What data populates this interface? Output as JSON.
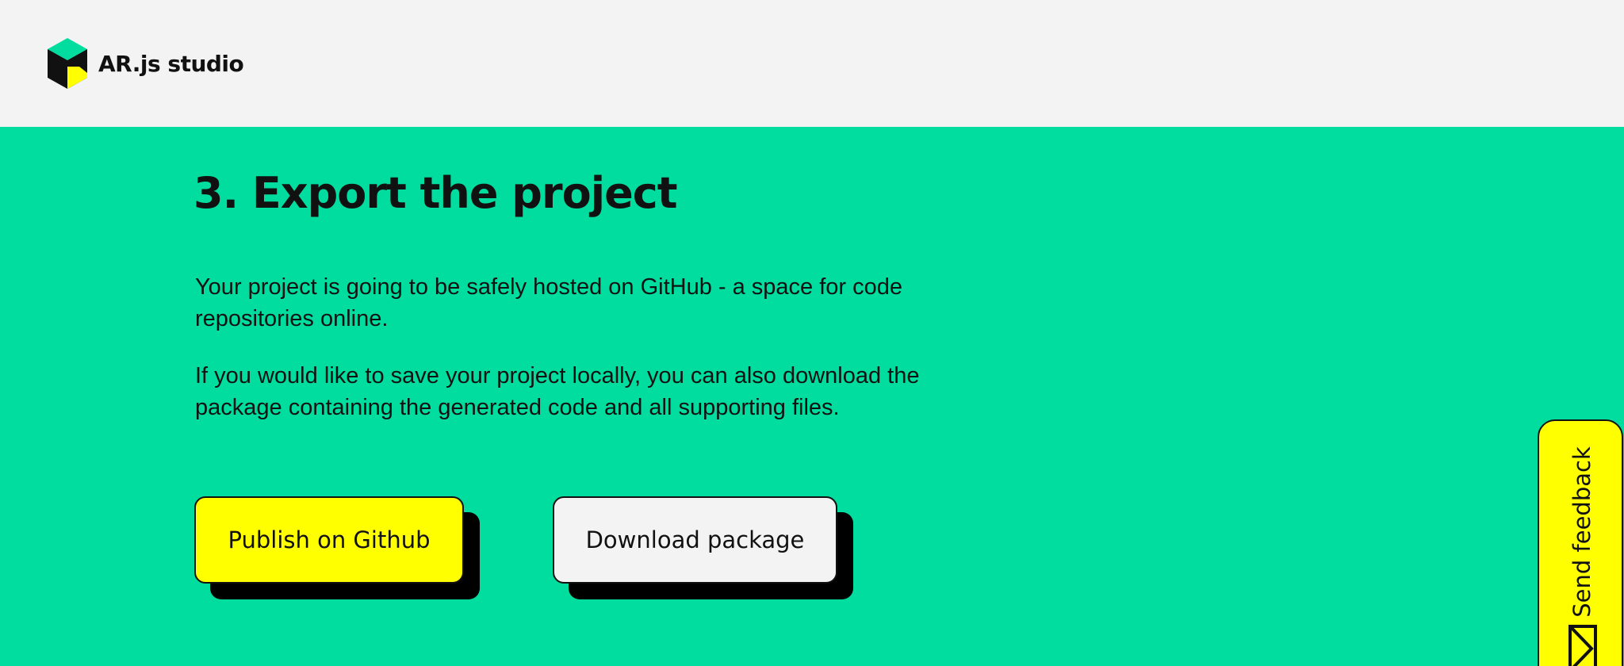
{
  "header": {
    "brand_name": "AR.js studio",
    "logo_icon": "arjs-cube-logo",
    "background": "#f3f3f3"
  },
  "section": {
    "title": "3. Export the project",
    "paragraphs": [
      "Your project is going to be safely hosted on GitHub - a space for code repositories online.",
      "If you would like to save your project locally, you can also download the package containing the generated code and all supporting files."
    ]
  },
  "buttons": {
    "publish_label": "Publish on Github",
    "download_label": "Download package"
  },
  "feedback": {
    "label": "Send feedback",
    "icon": "envelope-icon"
  },
  "colors": {
    "page_background": "#00dd9f",
    "accent_yellow": "#ffff00",
    "light_gray": "#f3f3f3",
    "ink": "#111111"
  }
}
